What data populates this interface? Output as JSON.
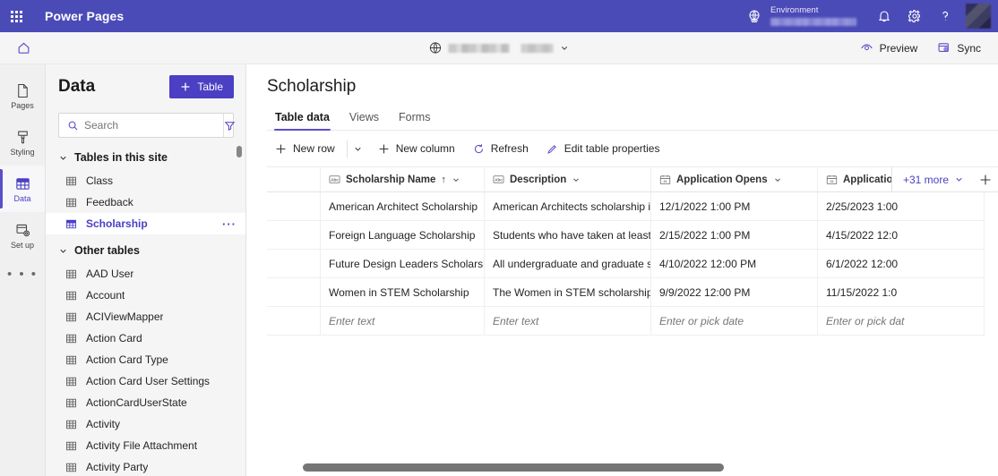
{
  "appbar": {
    "waffle_label": "app-launcher",
    "title": "Power Pages",
    "environment_label": "Environment",
    "notifications_label": "Notifications",
    "settings_label": "Settings",
    "help_label": "Help",
    "account_label": "Account manager"
  },
  "commandbar": {
    "home_label": "Home",
    "site_picker_label": "Site selector",
    "preview_label": "Preview",
    "sync_label": "Sync"
  },
  "rail": {
    "items": [
      {
        "label": "Pages",
        "icon": "page-icon",
        "active": false
      },
      {
        "label": "Styling",
        "icon": "brush-icon",
        "active": false
      },
      {
        "label": "Data",
        "icon": "table-grid-icon",
        "active": true
      },
      {
        "label": "Set up",
        "icon": "setup-icon",
        "active": false
      }
    ],
    "more_label": "• • •"
  },
  "datapanel": {
    "title": "Data",
    "new_table_button": "Table",
    "search_placeholder": "Search",
    "search_value": "",
    "filter_label": "Filter",
    "groups": [
      {
        "label": "Tables in this site",
        "expanded": true,
        "items": [
          {
            "name": "Class",
            "selected": false
          },
          {
            "name": "Feedback",
            "selected": false
          },
          {
            "name": "Scholarship",
            "selected": true,
            "overflow": "···"
          }
        ]
      },
      {
        "label": "Other tables",
        "expanded": true,
        "items": [
          {
            "name": "AAD User",
            "selected": false
          },
          {
            "name": "Account",
            "selected": false
          },
          {
            "name": "ACIViewMapper",
            "selected": false
          },
          {
            "name": "Action Card",
            "selected": false
          },
          {
            "name": "Action Card Type",
            "selected": false
          },
          {
            "name": "Action Card User Settings",
            "selected": false
          },
          {
            "name": "ActionCardUserState",
            "selected": false
          },
          {
            "name": "Activity",
            "selected": false
          },
          {
            "name": "Activity File Attachment",
            "selected": false
          },
          {
            "name": "Activity Party",
            "selected": false
          }
        ]
      }
    ]
  },
  "main": {
    "page_title": "Scholarship",
    "tabs": [
      {
        "label": "Table data",
        "active": true
      },
      {
        "label": "Views",
        "active": false
      },
      {
        "label": "Forms",
        "active": false
      }
    ],
    "toolbar": {
      "new_row": "New row",
      "new_row_caret": "chevron-down-icon",
      "new_column": "New column",
      "refresh": "Refresh",
      "edit_table_properties": "Edit table properties"
    },
    "grid": {
      "columns": [
        {
          "label": "Scholarship Name",
          "type_icon": "abc-icon",
          "sorted": "ascending",
          "sort_glyph": "↑",
          "menu": "chevron-down-icon"
        },
        {
          "label": "Description",
          "type_icon": "abc-icon",
          "sorted": "none",
          "menu": "chevron-down-icon"
        },
        {
          "label": "Application Opens",
          "type_icon": "calendar-icon",
          "sorted": "none",
          "menu": "chevron-down-icon"
        },
        {
          "label": "Application D",
          "type_icon": "calendar-icon",
          "sorted": "none",
          "menu": "chevron-down-icon"
        }
      ],
      "more_columns_chip": "+31 more",
      "add_column_label": "Add column",
      "rows": [
        {
          "name": "American Architect Scholarship",
          "description": "American Architects scholarship is…",
          "opens": "12/1/2022 1:00 PM",
          "deadline": "2/25/2023 1:00"
        },
        {
          "name": "Foreign Language Scholarship",
          "description": "Students who have taken at least …",
          "opens": "2/15/2022 1:00 PM",
          "deadline": "4/15/2022 12:0"
        },
        {
          "name": "Future Design Leaders Scholarship",
          "description": "All undergraduate and graduate s…",
          "opens": "4/10/2022 12:00 PM",
          "deadline": "6/1/2022 12:00"
        },
        {
          "name": "Women in STEM Scholarship",
          "description": "The Women in STEM scholarship i…",
          "opens": "9/9/2022 12:00 PM",
          "deadline": "11/15/2022 1:0"
        }
      ],
      "new_row_placeholders": {
        "name": "Enter text",
        "description": "Enter text",
        "opens": "Enter or pick date",
        "deadline": "Enter or pick dat"
      }
    }
  },
  "colors": {
    "brand_purple": "#4b3fc4",
    "appbar_purple": "#4b4bb8",
    "accent_underline": "#5b4ec9"
  }
}
